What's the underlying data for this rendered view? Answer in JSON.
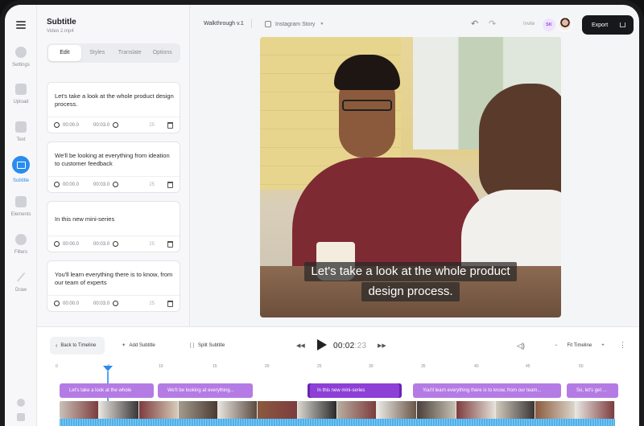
{
  "rail": {
    "items": [
      {
        "label": "Settings",
        "icon": "settings-icon"
      },
      {
        "label": "Upload",
        "icon": "upload-icon"
      },
      {
        "label": "Text",
        "icon": "text-icon"
      },
      {
        "label": "Subtitle",
        "icon": "subtitle-icon",
        "active": true
      },
      {
        "label": "Elements",
        "icon": "elements-icon"
      },
      {
        "label": "Filters",
        "icon": "filters-icon"
      },
      {
        "label": "Draw",
        "icon": "draw-icon"
      }
    ]
  },
  "panel": {
    "title": "Subtitle",
    "subtitle": "Video 2.mp4",
    "tabs": [
      "Edit",
      "Styles",
      "Translate",
      "Options"
    ],
    "active_tab": "Edit",
    "cards": [
      {
        "text": "Let's take a look at the whole product design process.",
        "start": "00:00.0",
        "end": "00:03.0",
        "count": "25"
      },
      {
        "text": "We'll be looking at everything from ideation to customer feedback",
        "start": "00:00.0",
        "end": "00:03.0",
        "count": "25"
      },
      {
        "text": "In this new mini-series",
        "start": "00:00.0",
        "end": "00:03.0",
        "count": "25"
      },
      {
        "text": "You'll learn everything there is to know, from our team of experts",
        "start": "00:00.0",
        "end": "00:03.0",
        "count": "25"
      }
    ]
  },
  "topbar": {
    "project": "Walkthrough v.1",
    "format": "Instagram Story",
    "undo": "↶",
    "redo": "↷",
    "invite": "Invite",
    "user_initials": "SK",
    "export_label": "Export"
  },
  "video": {
    "caption_line1": "Let's take a look at the whole product",
    "caption_line2": "design process."
  },
  "timeline": {
    "back_label": "Back to Timeline",
    "add_subtitle": "Add Subtitle",
    "split_subtitle": "Split Subtitle",
    "time_current": "00:02",
    "time_frames": ":23",
    "fit_timeline": "Fit Timeline",
    "ruler_ticks": [
      "0",
      "5",
      "10",
      "15",
      "20",
      "25",
      "30",
      "35",
      "40",
      "45",
      "50"
    ],
    "chips": [
      "Let's take a look at the whole",
      "We'll be looking at everything...",
      "In this new mini-series",
      "You'll learn everything there is to know, from our team...",
      "So, let's get ..."
    ],
    "accent": "#2a8cf0",
    "chip_color": "#b57be4"
  }
}
